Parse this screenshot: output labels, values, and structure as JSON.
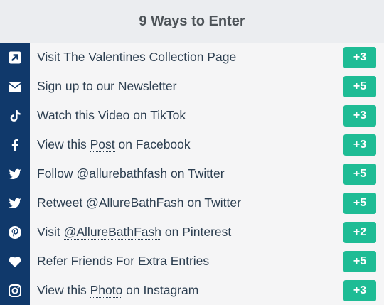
{
  "header": {
    "title": "9 Ways to Enter"
  },
  "entries": [
    {
      "icon": "external-link-icon",
      "label_parts": [
        {
          "text": "Visit The Valentines Collection Page",
          "u": false
        }
      ],
      "points": "+3"
    },
    {
      "icon": "envelope-icon",
      "label_parts": [
        {
          "text": "Sign up to our Newsletter",
          "u": false
        }
      ],
      "points": "+5"
    },
    {
      "icon": "tiktok-icon",
      "label_parts": [
        {
          "text": "Watch this Video on TikTok",
          "u": false
        }
      ],
      "points": "+3"
    },
    {
      "icon": "facebook-icon",
      "label_parts": [
        {
          "text": "View this ",
          "u": false
        },
        {
          "text": "Post",
          "u": true
        },
        {
          "text": " on Facebook",
          "u": false
        }
      ],
      "points": "+3"
    },
    {
      "icon": "twitter-icon",
      "label_parts": [
        {
          "text": "Follow ",
          "u": false
        },
        {
          "text": "@allurebathfash",
          "u": true
        },
        {
          "text": " on Twitter",
          "u": false
        }
      ],
      "points": "+5"
    },
    {
      "icon": "twitter-icon",
      "label_parts": [
        {
          "text": "Retweet @AllureBathFash",
          "u": true
        },
        {
          "text": " on Twitter",
          "u": false
        }
      ],
      "points": "+5"
    },
    {
      "icon": "pinterest-icon",
      "label_parts": [
        {
          "text": "Visit ",
          "u": false
        },
        {
          "text": "@AllureBathFash",
          "u": true
        },
        {
          "text": " on Pinterest",
          "u": false
        }
      ],
      "points": "+2"
    },
    {
      "icon": "heart-icon",
      "label_parts": [
        {
          "text": "Refer Friends For Extra Entries",
          "u": false
        }
      ],
      "points": "+5"
    },
    {
      "icon": "instagram-icon",
      "label_parts": [
        {
          "text": "View this ",
          "u": false
        },
        {
          "text": "Photo",
          "u": true
        },
        {
          "text": " on Instagram",
          "u": false
        }
      ],
      "points": "+3"
    }
  ],
  "colors": {
    "icon_bg": "#10396b",
    "badge_bg": "#1ebc95",
    "row_bg": "#f5f5f6",
    "header_bg": "#ebedf0",
    "text": "#2c3e50"
  }
}
